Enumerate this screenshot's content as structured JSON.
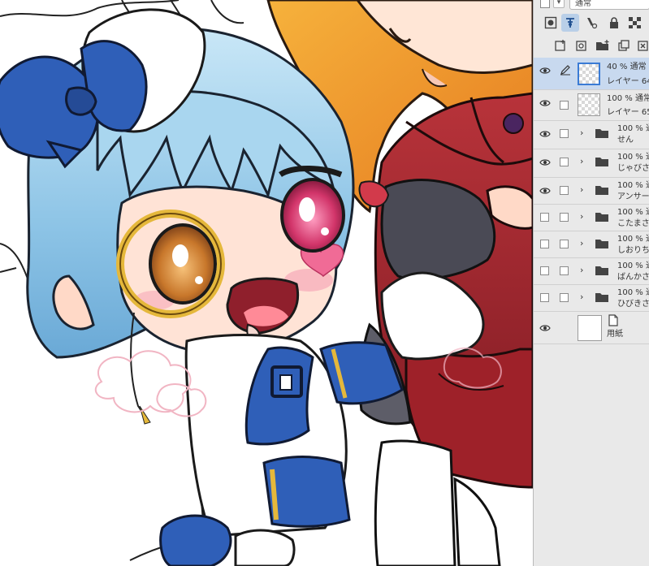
{
  "panel": {
    "blend_mode": "通常",
    "layers": [
      {
        "opacity_mode": "40 % 通常",
        "name": "レイヤー 64",
        "visible": true,
        "selected": true,
        "kind": "raster",
        "editing": true
      },
      {
        "opacity_mode": "100 % 通常",
        "name": "レイヤー 65",
        "visible": true,
        "selected": false,
        "kind": "raster"
      },
      {
        "opacity_mode": "100 % 通",
        "name": "せん",
        "visible": true,
        "kind": "folder"
      },
      {
        "opacity_mode": "100 % 通",
        "name": "じゃびさ",
        "visible": true,
        "kind": "folder"
      },
      {
        "opacity_mode": "100 % 通",
        "name": "アンサー",
        "visible": true,
        "kind": "folder"
      },
      {
        "opacity_mode": "100 % 通",
        "name": "こたまさ",
        "visible": false,
        "kind": "folder"
      },
      {
        "opacity_mode": "100 % 通",
        "name": "しおりち",
        "visible": false,
        "kind": "folder"
      },
      {
        "opacity_mode": "100 % 通",
        "name": "ばんかさ",
        "visible": false,
        "kind": "folder"
      },
      {
        "opacity_mode": "100 % 通",
        "name": "ひびきさ",
        "visible": false,
        "kind": "folder"
      },
      {
        "opacity_mode": "",
        "name": "用紙",
        "visible": true,
        "kind": "paper"
      }
    ],
    "toolbar_icons": [
      "layer-mask-icon",
      "reference-layer-icon",
      "palette-color-icon",
      "lock-icon",
      "transparency-lock-icon",
      "new-raster-layer-icon",
      "new-vector-layer-icon",
      "new-folder-icon",
      "duplicate-layer-icon",
      "delete-layer-icon"
    ]
  },
  "canvas": {
    "subject": "illustration"
  },
  "colors": {
    "hair_blue": "#9fd0ec",
    "ribbon_blue": "#2f5fb8",
    "gold": "#e8c24a",
    "red_coat": "#a8282f",
    "skin": "#ffe8dc",
    "selection_blue": "#c8d9ef"
  }
}
